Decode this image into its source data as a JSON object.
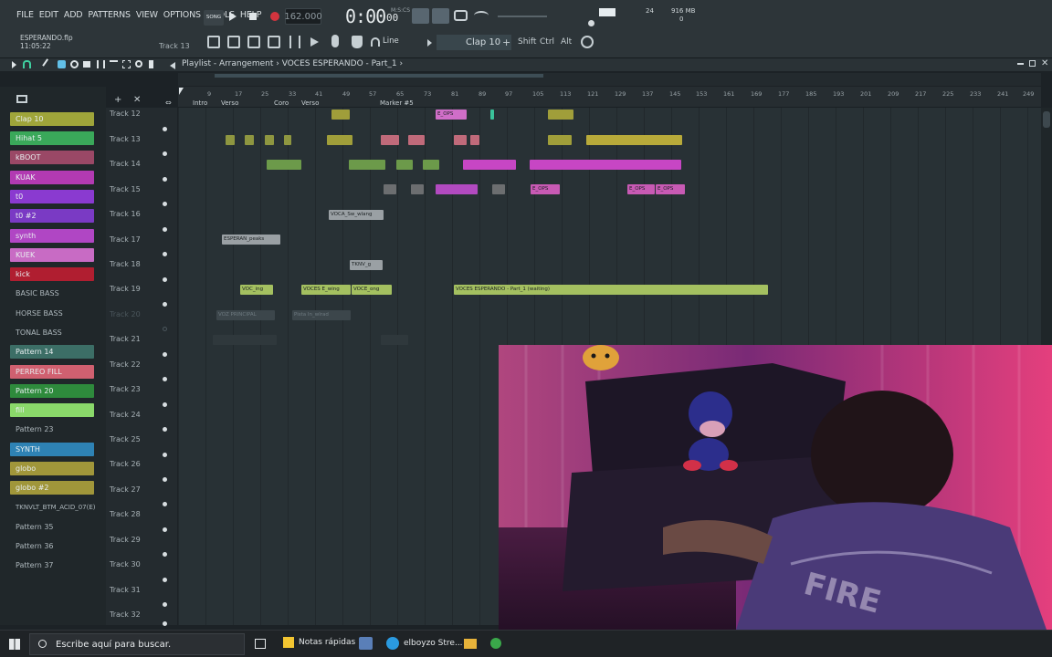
{
  "menu": [
    "FILE",
    "EDIT",
    "ADD",
    "PATTERNS",
    "VIEW",
    "OPTIONS",
    "TOOLS",
    "HELP"
  ],
  "transport": {
    "tempo": "162.000",
    "time": "0:00",
    "time_sub": "00",
    "time_unit": "M:S:CS",
    "song_mode": "SONG"
  },
  "project": {
    "file": "ESPERANDO.flp",
    "clock": "11:05:22",
    "hint_track": "Track 13"
  },
  "toolbar": {
    "pattern": "Clap 10",
    "snap": "Line",
    "keys": [
      "Shift",
      "Ctrl",
      "Alt"
    ],
    "cpu": "24",
    "memory": "916 MB",
    "voices": "0"
  },
  "playlist": {
    "title": "Playlist - Arrangement",
    "breadcrumb": "VOCES ESPERANDO - Part_1"
  },
  "ruler": {
    "bars": [
      "9",
      "17",
      "25",
      "33",
      "41",
      "49",
      "57",
      "65",
      "73",
      "81",
      "89",
      "97",
      "105",
      "113",
      "121",
      "129",
      "137",
      "145",
      "153",
      "161",
      "169",
      "177",
      "185",
      "193",
      "201",
      "209",
      "217",
      "225",
      "233",
      "241",
      "249"
    ],
    "markers": [
      "Intro",
      "Verso",
      "Coro",
      "Verso",
      "Marker #5"
    ]
  },
  "channels": [
    {
      "label": "Clap 10",
      "color": "#9fa53a"
    },
    {
      "label": "Hihat 5",
      "color": "#3aa85a"
    },
    {
      "label": "kBOOT",
      "color": "#9a4866"
    },
    {
      "label": "KUAK",
      "color": "#b23ab2"
    },
    {
      "label": "t0",
      "color": "#8a3ad0"
    },
    {
      "label": "t0 #2",
      "color": "#7a3ac4"
    },
    {
      "label": "synth",
      "color": "#b046c4"
    },
    {
      "label": "KUEK",
      "color": "#c86bc4"
    },
    {
      "label": "kick",
      "color": "#b01e30"
    },
    {
      "label": "BASIC BASS",
      "color": ""
    },
    {
      "label": "HORSE BASS",
      "color": ""
    },
    {
      "label": "TONAL BASS",
      "color": ""
    },
    {
      "label": "Pattern 14",
      "color": "#3c6e66"
    },
    {
      "label": "PERREO FILL",
      "color": "#d06070"
    },
    {
      "label": "Pattern 20",
      "color": "#2e8a3c"
    },
    {
      "label": "fill",
      "color": "#8ad86a"
    },
    {
      "label": "Pattern 23",
      "color": ""
    },
    {
      "label": "SYNTH",
      "color": "#2e82b4"
    },
    {
      "label": "globo",
      "color": "#a0963a"
    },
    {
      "label": "globo #2",
      "color": "#a0963a"
    },
    {
      "label": "TKNVLT_BTM_ACID_07(E)",
      "color": ""
    },
    {
      "label": "Pattern 35",
      "color": ""
    },
    {
      "label": "Pattern 36",
      "color": ""
    },
    {
      "label": "Pattern 37",
      "color": ""
    }
  ],
  "tracks": [
    "Track 12",
    "Track 13",
    "Track 14",
    "Track 15",
    "Track 16",
    "Track 17",
    "Track 18",
    "Track 19",
    "Track 20",
    "Track 21",
    "Track 22",
    "Track 23",
    "Track 24",
    "Track 25",
    "Track 26",
    "Track 27",
    "Track 28",
    "Track 29",
    "Track 30",
    "Track 31",
    "Track 32"
  ],
  "clips": {
    "esperan_peaks": "ESPERAN_peaks",
    "vocal_clip": "VOCA_Sw_wlang",
    "tknv": "TKNV_g",
    "voc_ing": "VOC_ing",
    "voces_e": "VOCES E_wing",
    "voce_ong": "VOCE_ong",
    "voces_long": "VOCES ESPERANDO - Part_1 (waiting)",
    "e_ops": "E_OPS",
    "voz_principal": "VOZ PRINCIPAL",
    "pista": "Pista In_wlrad"
  },
  "taskbar": {
    "search_placeholder": "Escribe aquí para buscar.",
    "notes": "Notas rápidas",
    "browser": "elboyzo Stre..."
  }
}
